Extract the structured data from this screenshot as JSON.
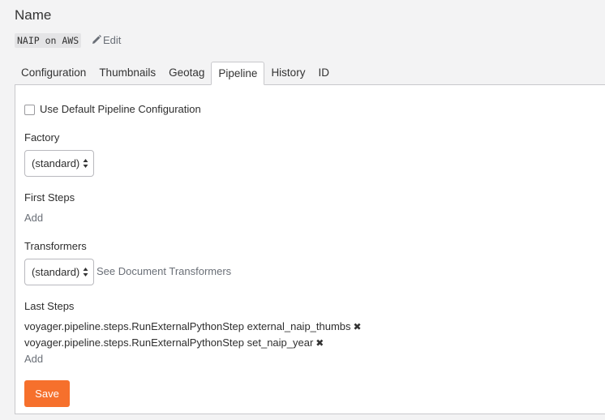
{
  "header": {
    "title": "Name",
    "code_name": "NAIP on AWS",
    "edit_label": "Edit"
  },
  "tabs": [
    {
      "label": "Configuration"
    },
    {
      "label": "Thumbnails"
    },
    {
      "label": "Geotag"
    },
    {
      "label": "Pipeline"
    },
    {
      "label": "History"
    },
    {
      "label": "ID"
    }
  ],
  "active_tab": "Pipeline",
  "pipeline": {
    "use_default_label": "Use Default Pipeline Configuration",
    "use_default_checked": false,
    "factory_label": "Factory",
    "factory_value": "(standard)",
    "first_steps_label": "First Steps",
    "first_steps_add": "Add",
    "transformers_label": "Transformers",
    "transformers_value": "(standard)",
    "see_transformers_label": "See Document Transformers",
    "last_steps_label": "Last Steps",
    "last_steps": [
      {
        "text": "voyager.pipeline.steps.RunExternalPythonStep external_naip_thumbs"
      },
      {
        "text": "voyager.pipeline.steps.RunExternalPythonStep set_naip_year"
      }
    ],
    "last_steps_add": "Add",
    "save_label": "Save"
  },
  "colors": {
    "accent": "#f6702c",
    "link": "#6a6f77",
    "background": "#f3f3f4"
  }
}
